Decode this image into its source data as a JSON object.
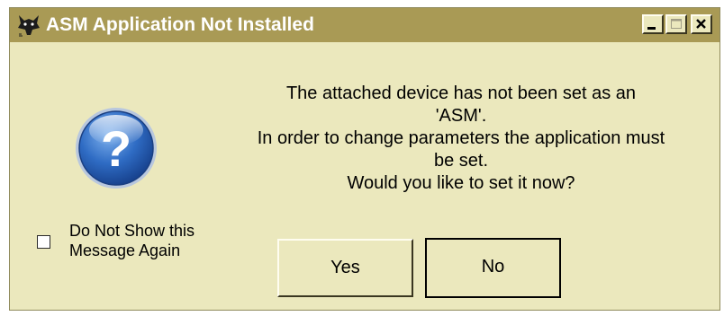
{
  "window": {
    "title": "ASM Application Not Installed",
    "title_bar_color": "#a99a55",
    "background_color": "#ebe8bd",
    "app_icon": "wolf-head-icon",
    "controls": {
      "minimize_icon": "minimize-icon",
      "maximize_icon": "maximize-icon",
      "close_icon": "close-icon"
    }
  },
  "dialog": {
    "icon": "question-icon",
    "message_lines": [
      "The attached device has not been set as an",
      "'ASM'.",
      "In order to change parameters the application must",
      "be set.",
      "Would you like to set it now?"
    ],
    "checkbox": {
      "checked": false,
      "label_lines": [
        "Do Not Show this",
        "Message Again"
      ]
    },
    "buttons": {
      "yes_label": "Yes",
      "no_label": "No",
      "default": "No"
    }
  }
}
